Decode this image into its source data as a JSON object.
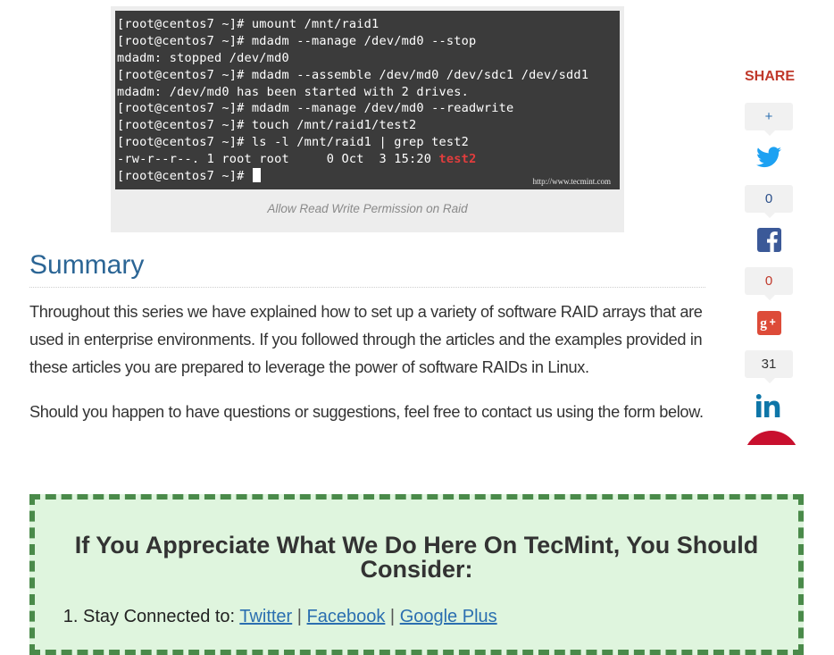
{
  "figure": {
    "terminal_lines": [
      "[root@centos7 ~]# umount /mnt/raid1",
      "[root@centos7 ~]# mdadm --manage /dev/md0 --stop",
      "mdadm: stopped /dev/md0",
      "[root@centos7 ~]# mdadm --assemble /dev/md0 /dev/sdc1 /dev/sdd1",
      "mdadm: /dev/md0 has been started with 2 drives.",
      "[root@centos7 ~]# mdadm --manage /dev/md0 --readwrite",
      "[root@centos7 ~]# touch /mnt/raid1/test2",
      "[root@centos7 ~]# ls -l /mnt/raid1 | grep test2"
    ],
    "ls_output_prefix": "-rw-r--r--. 1 root root     0 Oct  3 15:20 ",
    "ls_output_highlight": "test2",
    "prompt_last": "[root@centos7 ~]# ",
    "watermark": "http://www.tecmint.com",
    "caption": "Allow Read Write Permission on Raid"
  },
  "article": {
    "heading": "Summary",
    "paragraph1": "Throughout this series we have explained how to set up a variety of software RAID arrays that are used in enterprise environments. If you followed through the articles and the examples provided in these articles you are prepared to leverage the power of software RAIDs in Linux.",
    "paragraph2": "Should you happen to have questions or suggestions, feel free to contact us using the form below."
  },
  "share": {
    "title": "SHARE",
    "plus_label": "+",
    "twitter_count": "0",
    "facebook_count": "0",
    "googleplus_count": "31",
    "colors": {
      "title": "#c0392b",
      "twitter": "#1da1f2",
      "facebook": "#3b5998",
      "googleplus": "#dd4b39",
      "linkedin": "#0e76a8"
    }
  },
  "appreciate": {
    "heading": "If You Appreciate What We Do Here On TecMint, You Should Consider:",
    "item1_prefix": "Stay Connected to: ",
    "links": [
      "Twitter",
      "Facebook",
      "Google Plus"
    ],
    "separator": " | "
  }
}
